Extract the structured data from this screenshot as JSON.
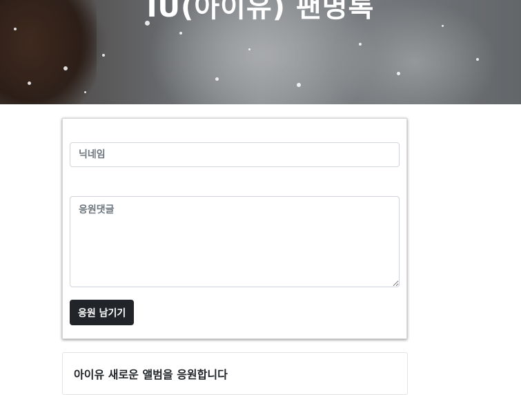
{
  "hero": {
    "title": "IU(아이유) 팬명록"
  },
  "form": {
    "nickname_placeholder": "닉네임",
    "comment_placeholder": "응원댓글",
    "submit_label": "응원 남기기"
  },
  "comments": [
    {
      "text": "아이유 새로운 앨범을 응원합니다"
    }
  ]
}
